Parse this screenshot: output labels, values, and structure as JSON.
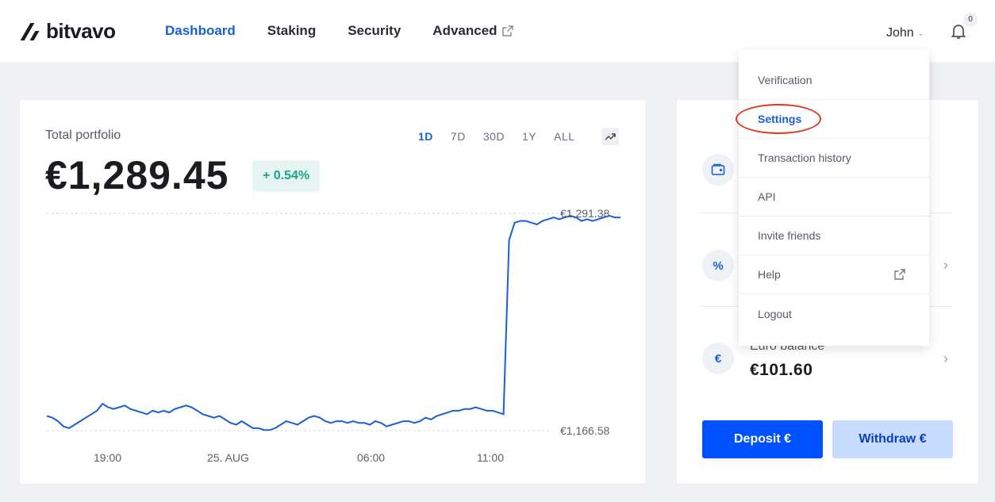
{
  "header": {
    "brand": "bitvavo",
    "nav": [
      {
        "label": "Dashboard",
        "active": true
      },
      {
        "label": "Staking",
        "active": false
      },
      {
        "label": "Security",
        "active": false
      },
      {
        "label": "Advanced",
        "external": true
      }
    ],
    "user_name": "John",
    "notification_count": "0"
  },
  "portfolio": {
    "label": "Total portfolio",
    "value": "€1,289.45",
    "change": "+ 0.54%",
    "ranges": [
      "1D",
      "7D",
      "30D",
      "1Y",
      "ALL"
    ],
    "active_range": "1D"
  },
  "chart_data": {
    "type": "line",
    "x_ticks": [
      "19:00",
      "25. AUG",
      "06:00",
      "11:00"
    ],
    "y_max_label": "€1,291.38",
    "y_min_label": "€1,166.58",
    "ylim": [
      1166.58,
      1291.38
    ],
    "series": [
      {
        "color": "#1a5fd6",
        "values": [
          1175,
          1174,
          1172,
          1169,
          1168,
          1170,
          1172,
          1174,
          1176,
          1178,
          1182,
          1180,
          1179,
          1180,
          1181,
          1179,
          1178,
          1177,
          1176,
          1178,
          1177,
          1178,
          1177,
          1179,
          1180,
          1181,
          1180,
          1178,
          1176,
          1175,
          1174,
          1175,
          1173,
          1171,
          1170,
          1172,
          1170,
          1168,
          1168,
          1167,
          1166.9,
          1168,
          1170,
          1172,
          1171,
          1170,
          1172,
          1174,
          1175,
          1174,
          1172,
          1171,
          1172,
          1172,
          1171,
          1172,
          1171,
          1171,
          1170,
          1172,
          1171,
          1169,
          1170,
          1171,
          1172,
          1172,
          1171,
          1172,
          1174,
          1173,
          1175,
          1176,
          1177,
          1178,
          1178,
          1179,
          1179,
          1180,
          1179,
          1178,
          1178,
          1177,
          1176,
          1276,
          1286,
          1287,
          1287,
          1286,
          1285,
          1287,
          1288,
          1289,
          1288,
          1289,
          1290,
          1289,
          1287,
          1288,
          1287,
          1288,
          1289,
          1290,
          1289,
          1289
        ]
      }
    ]
  },
  "accounts": {
    "euro_label": "Euro balance",
    "euro_value": "€101.60",
    "deposit_label": "Deposit €",
    "withdraw_label": "Withdraw €"
  },
  "menu": {
    "items": [
      {
        "label": "Verification"
      },
      {
        "label": "Settings",
        "active": true
      },
      {
        "label": "Transaction history"
      },
      {
        "label": "API"
      },
      {
        "label": "Invite friends"
      },
      {
        "label": "Help",
        "external": true
      },
      {
        "label": "Logout"
      }
    ]
  },
  "colors": {
    "accent": "#1a5fd6",
    "positive": "#1aa58a",
    "highlight": "#e2361d"
  }
}
